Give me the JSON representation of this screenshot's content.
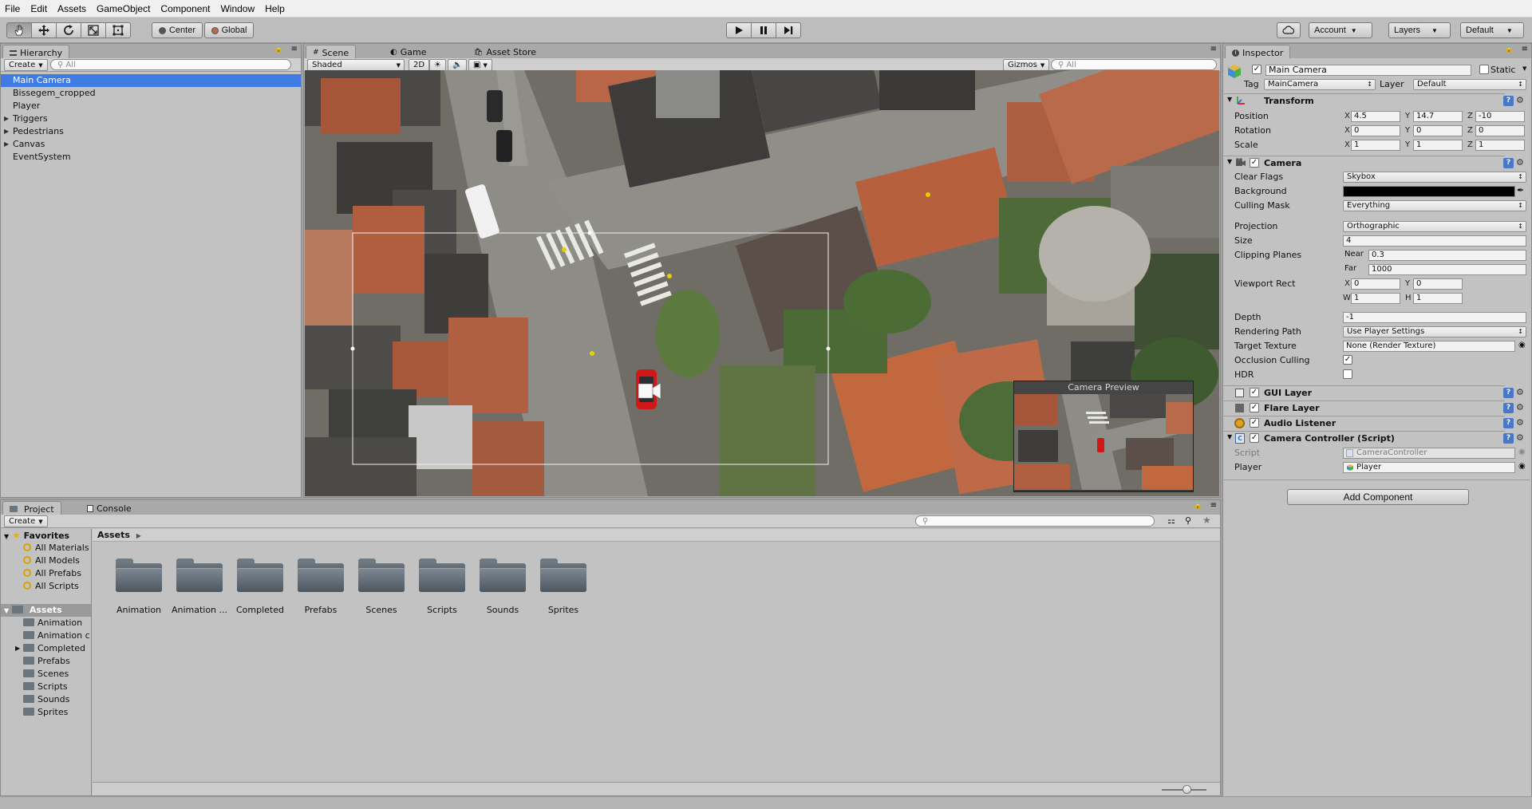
{
  "menubar": {
    "items": [
      "File",
      "Edit",
      "Assets",
      "GameObject",
      "Component",
      "Window",
      "Help"
    ]
  },
  "toolbar": {
    "tools": [
      "hand-tool",
      "move-tool",
      "rotate-tool",
      "scale-tool",
      "rect-tool"
    ],
    "pivot_label": "Center",
    "space_label": "Global",
    "account_label": "Account",
    "layers_label": "Layers",
    "layout_label": "Default"
  },
  "hierarchy": {
    "tab_label": "Hierarchy",
    "create_label": "Create",
    "search_placeholder": "All",
    "items": [
      {
        "label": "Main Camera",
        "selected": true,
        "expandable": false
      },
      {
        "label": "Bissegem_cropped",
        "selected": false,
        "expandable": false
      },
      {
        "label": "Player",
        "selected": false,
        "expandable": false
      },
      {
        "label": "Triggers",
        "selected": false,
        "expandable": true
      },
      {
        "label": "Pedestrians",
        "selected": false,
        "expandable": true
      },
      {
        "label": "Canvas",
        "selected": false,
        "expandable": true
      },
      {
        "label": "EventSystem",
        "selected": false,
        "expandable": false
      }
    ]
  },
  "scene": {
    "tabs": [
      "Scene",
      "Game",
      "Asset Store"
    ],
    "shading_mode": "Shaded",
    "mode_2d_label": "2D",
    "gizmos_label": "Gizmos",
    "search_placeholder": "All",
    "camera_preview_title": "Camera Preview"
  },
  "inspector": {
    "tab_label": "Inspector",
    "object_name": "Main Camera",
    "static_label": "Static",
    "tag_label": "Tag",
    "tag_value": "MainCamera",
    "layer_label": "Layer",
    "layer_value": "Default",
    "transform": {
      "title": "Transform",
      "position_label": "Position",
      "position": {
        "x": "4.5",
        "y": "14.7",
        "z": "-10"
      },
      "rotation_label": "Rotation",
      "rotation": {
        "x": "0",
        "y": "0",
        "z": "0"
      },
      "scale_label": "Scale",
      "scale": {
        "x": "1",
        "y": "1",
        "z": "1"
      }
    },
    "camera": {
      "title": "Camera",
      "clear_flags_label": "Clear Flags",
      "clear_flags": "Skybox",
      "background_label": "Background",
      "background_color": "#000000",
      "culling_mask_label": "Culling Mask",
      "culling_mask": "Everything",
      "projection_label": "Projection",
      "projection": "Orthographic",
      "size_label": "Size",
      "size": "4",
      "clipping_planes_label": "Clipping Planes",
      "near_label": "Near",
      "near": "0.3",
      "far_label": "Far",
      "far": "1000",
      "viewport_rect_label": "Viewport Rect",
      "viewport": {
        "x": "0",
        "y": "0",
        "w": "1",
        "h": "1"
      },
      "depth_label": "Depth",
      "depth": "-1",
      "rendering_path_label": "Rendering Path",
      "rendering_path": "Use Player Settings",
      "target_texture_label": "Target Texture",
      "target_texture": "None (Render Texture)",
      "occlusion_culling_label": "Occlusion Culling",
      "occlusion_culling": true,
      "hdr_label": "HDR",
      "hdr": false
    },
    "components": [
      "GUI Layer",
      "Flare Layer",
      "Audio Listener"
    ],
    "camera_controller": {
      "title": "Camera Controller (Script)",
      "script_label": "Script",
      "script_value": "CameraController",
      "player_label": "Player",
      "player_value": "Player"
    },
    "add_component_label": "Add Component"
  },
  "project": {
    "tabs": [
      "Project",
      "Console"
    ],
    "create_label": "Create",
    "favorites_label": "Favorites",
    "favorites": [
      "All Materials",
      "All Models",
      "All Prefabs",
      "All Scripts"
    ],
    "assets_label": "Assets",
    "tree_folders": [
      "Animation",
      "Animation c",
      "Completed",
      "Prefabs",
      "Scenes",
      "Scripts",
      "Sounds",
      "Sprites"
    ],
    "breadcrumb": "Assets",
    "grid_folders": [
      "Animation",
      "Animation ...",
      "Completed",
      "Prefabs",
      "Scenes",
      "Scripts",
      "Sounds",
      "Sprites"
    ]
  },
  "colors": {
    "selection": "#3e7ce4",
    "panel": "#c2c2c2",
    "car_red": "#d01818"
  }
}
